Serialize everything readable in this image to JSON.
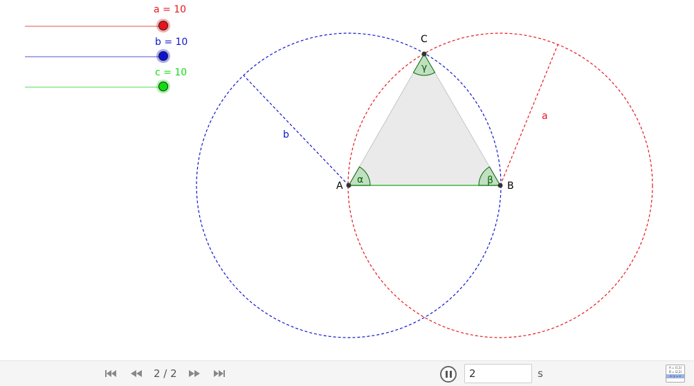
{
  "sliders": [
    {
      "label": "a = 10",
      "color": "#e8141c"
    },
    {
      "label": "b = 10",
      "color": "#0c13d0"
    },
    {
      "label": "c = 10",
      "color": "#10dd10"
    }
  ],
  "points": {
    "A": "A",
    "B": "B",
    "C": "C"
  },
  "sides": {
    "a": "a",
    "b": "b"
  },
  "angles": {
    "alpha": "α",
    "beta": "β",
    "gamma": "γ"
  },
  "colors": {
    "circle_a": "#e8141c",
    "circle_b": "#0c13d0",
    "side_c": "#3cb83c",
    "angle_fill": "#b6dcb6",
    "angle_stroke": "#006400",
    "triangle_fill": "#e6e6e6"
  },
  "toolbar": {
    "page_counter": "2 / 2",
    "speed_value": "2",
    "unit": "s",
    "algebra_lines": [
      "A = (1,1)",
      "B = (2,2)",
      "a: y = x"
    ]
  },
  "icons": {
    "first": "skip-first-icon",
    "prev": "rewind-icon",
    "next": "fast-forward-icon",
    "last": "skip-last-icon",
    "pause": "pause-icon",
    "algebra": "algebra-view-icon"
  }
}
